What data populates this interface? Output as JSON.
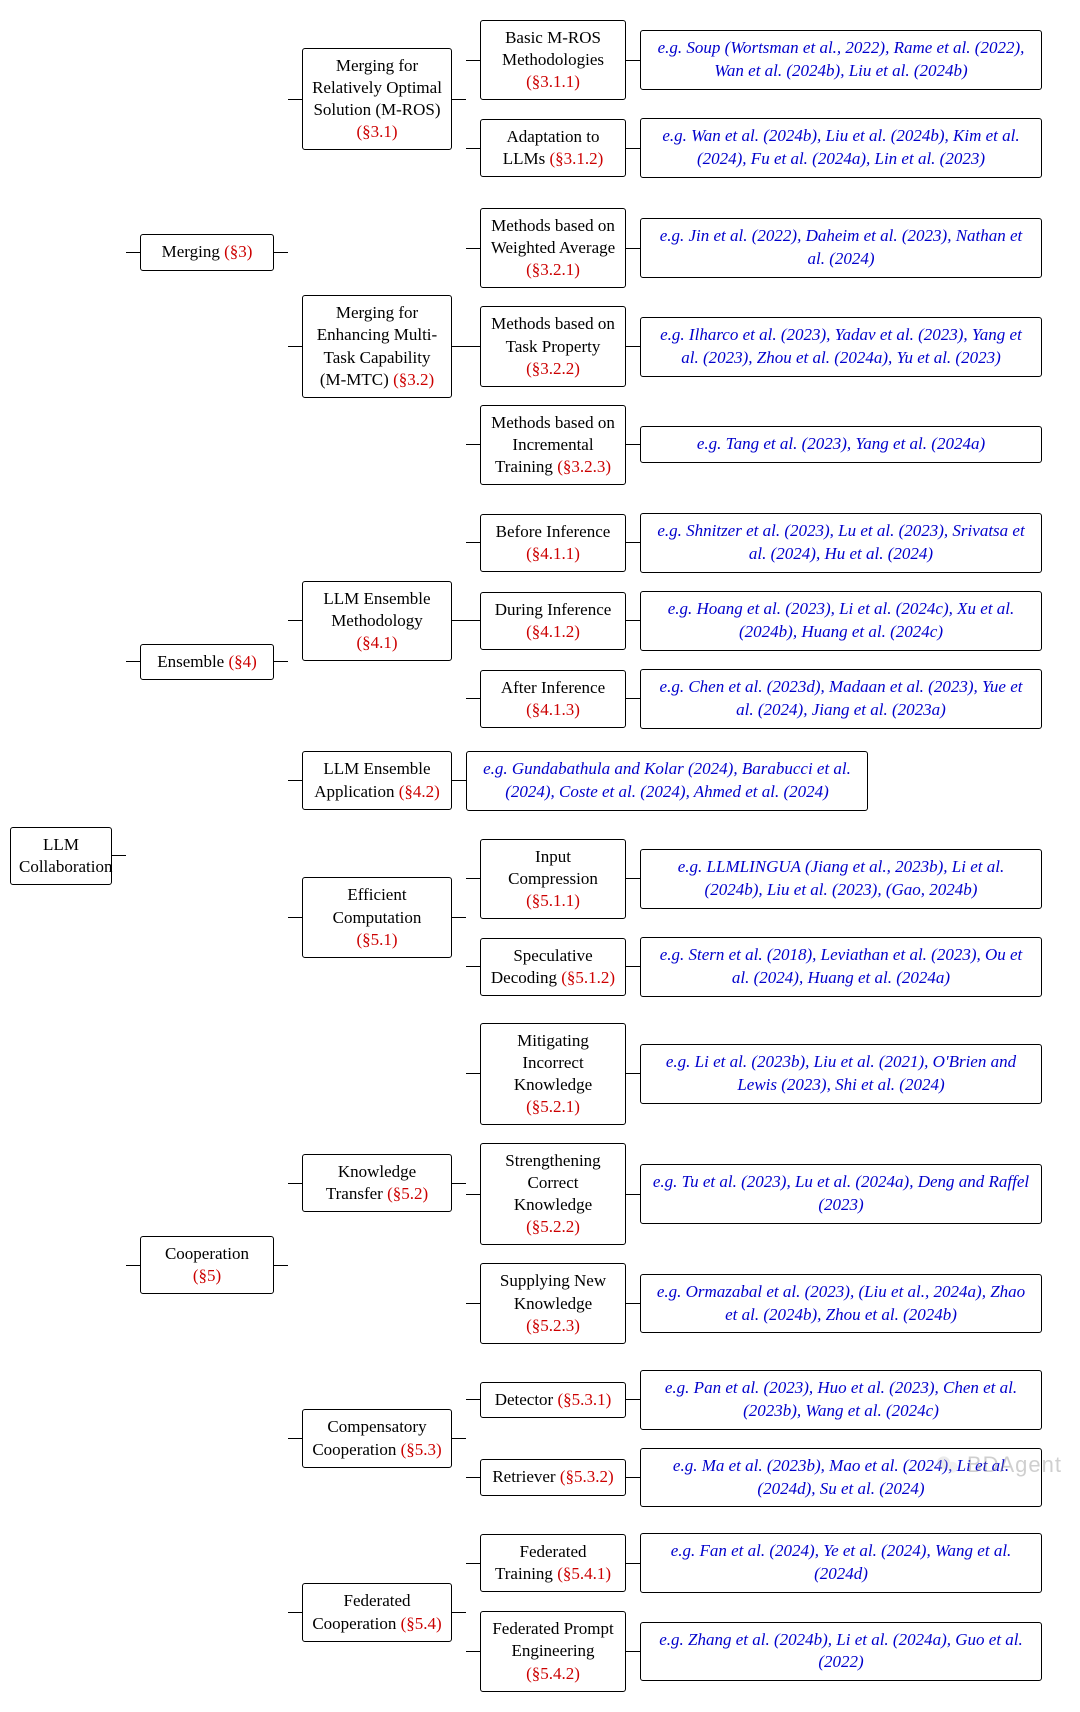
{
  "root": {
    "text": "LLM Collaboration"
  },
  "merging": {
    "label": "Merging",
    "sec": "(§3)"
  },
  "mros": {
    "label": "Merging for Relatively Optimal Solution (M-ROS)",
    "sec": "(§3.1)"
  },
  "mros1": {
    "label": "Basic M-ROS Methodologies",
    "sec": "(§3.1.1)"
  },
  "mros1_leaf": "e.g. Soup (Wortsman et al., 2022), Rame et al. (2022), Wan et al. (2024b), Liu et al. (2024b)",
  "mros2": {
    "label": "Adaptation to LLMs",
    "sec": "(§3.1.2)"
  },
  "mros2_leaf": "e.g. Wan et al. (2024b), Liu et al. (2024b), Kim et al. (2024), Fu et al. (2024a), Lin et al. (2023)",
  "mmtc": {
    "label": "Merging for Enhancing Multi-Task Capability (M-MTC)",
    "sec": "(§3.2)"
  },
  "mmtc1": {
    "label": "Methods based on Weighted Average",
    "sec": "(§3.2.1)"
  },
  "mmtc1_leaf": "e.g. Jin et al. (2022), Daheim et al. (2023), Nathan et al. (2024)",
  "mmtc2": {
    "label": "Methods based on Task Property",
    "sec": "(§3.2.2)"
  },
  "mmtc2_leaf": "e.g. Ilharco et al. (2023), Yadav et al. (2023), Yang et al. (2023), Zhou et al. (2024a), Yu et al. (2023)",
  "mmtc3": {
    "label": "Methods based on Incremental Training",
    "sec": "(§3.2.3)"
  },
  "mmtc3_leaf": "e.g. Tang et al. (2023), Yang et al. (2024a)",
  "ensemble": {
    "label": "Ensemble",
    "sec": "(§4)"
  },
  "ensM": {
    "label": "LLM Ensemble Methodology",
    "sec": "(§4.1)"
  },
  "ensM1": {
    "label": "Before Inference",
    "sec": "(§4.1.1)"
  },
  "ensM1_leaf": "e.g. Shnitzer et al. (2023), Lu et al. (2023), Srivatsa et al. (2024), Hu et al. (2024)",
  "ensM2": {
    "label": "During Inference",
    "sec": "(§4.1.2)"
  },
  "ensM2_leaf": "e.g. Hoang et al. (2023), Li et al. (2024c), Xu et al. (2024b), Huang et al. (2024c)",
  "ensM3": {
    "label": "After Inference",
    "sec": "(§4.1.3)"
  },
  "ensM3_leaf": "e.g. Chen et al. (2023d), Madaan et al. (2023), Yue et al. (2024), Jiang et al. (2023a)",
  "ensA": {
    "label": "LLM Ensemble Application",
    "sec": "(§4.2)"
  },
  "ensA_leaf": "e.g. Gundabathula and Kolar (2024), Barabucci et al. (2024), Coste et al. (2024), Ahmed et al. (2024)",
  "coop": {
    "label": "Cooperation",
    "sec": "(§5)"
  },
  "eff": {
    "label": "Efficient Computation",
    "sec": "(§5.1)"
  },
  "eff1": {
    "label": "Input Compression",
    "sec": "(§5.1.1)"
  },
  "eff1_leaf": "e.g. LLMLINGUA (Jiang et al., 2023b), Li et al. (2024b), Liu et al. (2023), (Gao, 2024b)",
  "eff2": {
    "label": "Speculative Decoding",
    "sec": "(§5.1.2)"
  },
  "eff2_leaf": "e.g. Stern et al. (2018), Leviathan et al. (2023), Ou et al. (2024), Huang et al. (2024a)",
  "kt": {
    "label": "Knowledge Transfer",
    "sec": "(§5.2)"
  },
  "kt1": {
    "label": "Mitigating Incorrect Knowledge",
    "sec": "(§5.2.1)"
  },
  "kt1_leaf": "e.g. Li et al. (2023b), Liu et al. (2021), O'Brien and Lewis (2023), Shi et al. (2024)",
  "kt2": {
    "label": "Strengthening Correct Knowledge",
    "sec": "(§5.2.2)"
  },
  "kt2_leaf": "e.g. Tu et al. (2023), Lu et al. (2024a), Deng and Raffel (2023)",
  "kt3": {
    "label": "Supplying New Knowledge",
    "sec": "(§5.2.3)"
  },
  "kt3_leaf": "e.g. Ormazabal et al. (2023), (Liu et al., 2024a), Zhao et al. (2024b), Zhou et al. (2024b)",
  "comp": {
    "label": "Compensatory Cooperation",
    "sec": "(§5.3)"
  },
  "comp1": {
    "label": "Detector",
    "sec": "(§5.3.1)"
  },
  "comp1_leaf": "e.g. Pan et al. (2023), Huo et al. (2023), Chen et al. (2023b), Wang et al. (2024c)",
  "comp2": {
    "label": "Retriever",
    "sec": "(§5.3.2)"
  },
  "comp2_leaf": "e.g. Ma et al. (2023b), Mao et al. (2024), Li et al. (2024d), Su et al. (2024)",
  "fed": {
    "label": "Federated Cooperation",
    "sec": "(§5.4)"
  },
  "fed1": {
    "label": "Federated Training",
    "sec": "(§5.4.1)"
  },
  "fed1_leaf": "e.g. Fan et al. (2024), Ye et al. (2024), Wang et al. (2024d)",
  "fed2": {
    "label": "Federated Prompt Engineering",
    "sec": "(§5.4.2)"
  },
  "fed2_leaf": "e.g. Zhang et al. (2024b), Li et al. (2024a), Guo et al. (2022)",
  "watermark": "BDAgent"
}
